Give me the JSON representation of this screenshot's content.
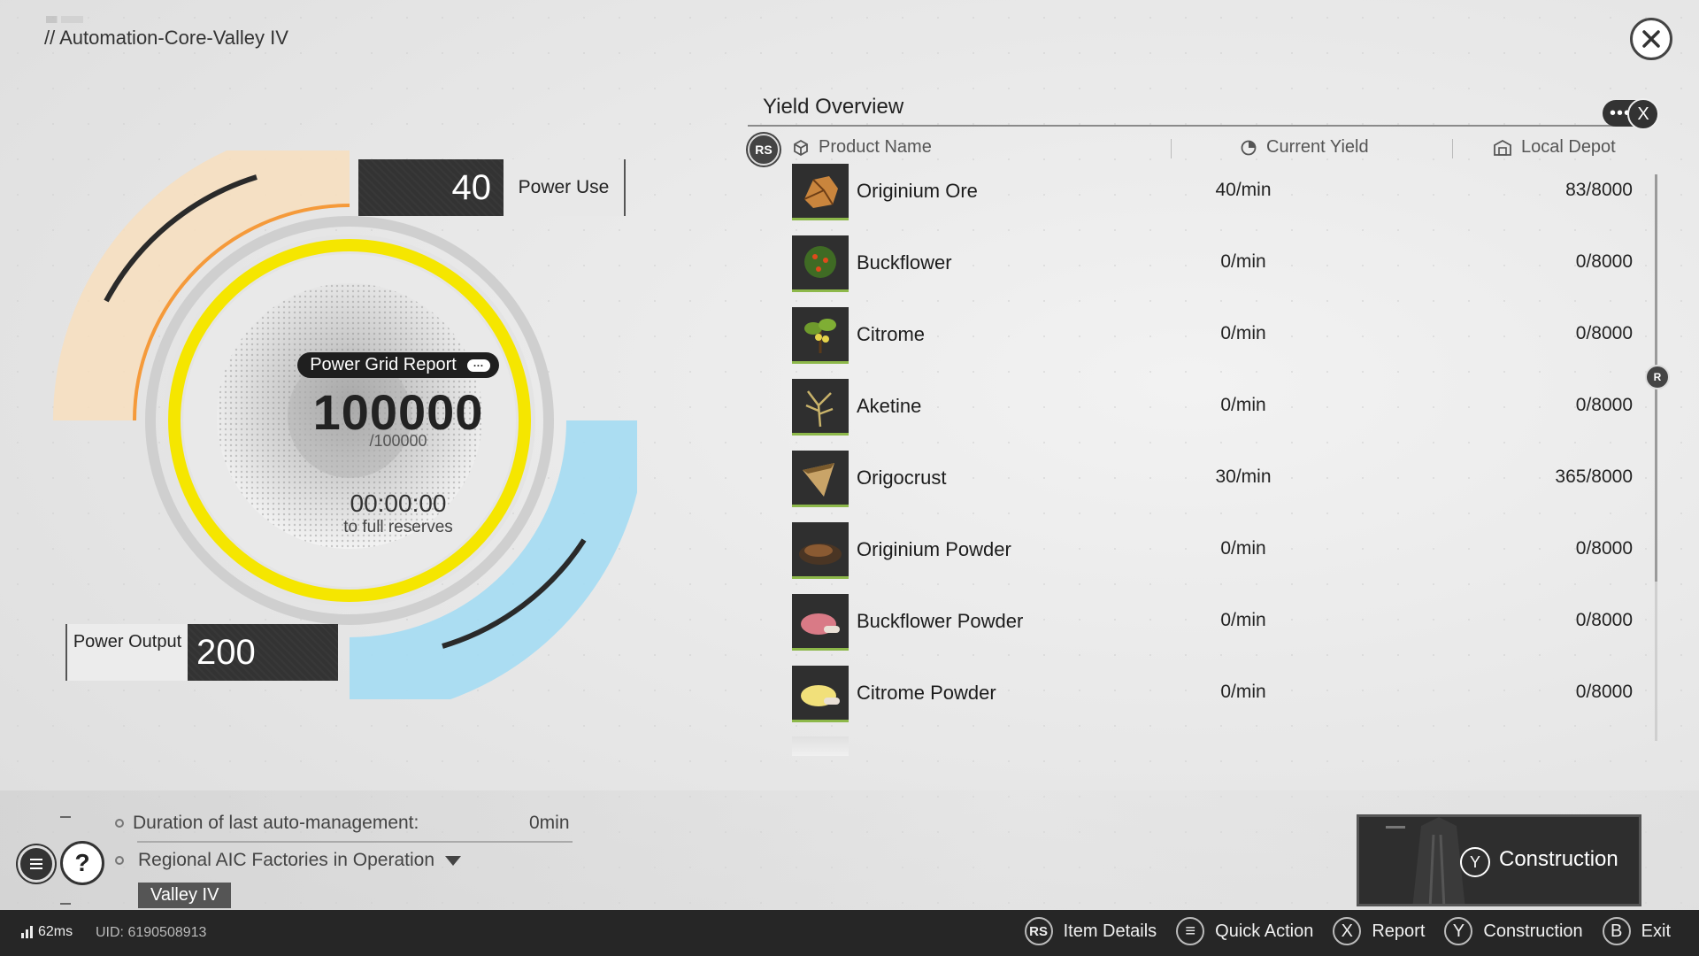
{
  "header": {
    "breadcrumb": "// Automation-Core-Valley IV"
  },
  "power": {
    "grid_report_label": "Power Grid Report",
    "current": "100000",
    "capacity": "/100000",
    "timer": "00:00:00",
    "timer_label": "to full reserves",
    "power_use_value": "40",
    "power_use_label": "Power Use",
    "power_output_value": "200",
    "power_output_label": "Power Output",
    "reserve_fill_fraction": 1.0,
    "colors": {
      "ring": "#f5e600",
      "use_arc": "#f7cf9a",
      "output_arc": "#8fd6f2"
    }
  },
  "yield": {
    "title": "Yield Overview",
    "col_product": "Product Name",
    "col_yield": "Current Yield",
    "col_depot": "Local Depot",
    "rs_badge": "RS",
    "scroll_badge": "R",
    "items": [
      {
        "name": "Originium Ore",
        "yield": "40/min",
        "depot": "83/8000",
        "icon": "originium-ore-icon"
      },
      {
        "name": "Buckflower",
        "yield": "0/min",
        "depot": "0/8000",
        "icon": "buckflower-icon"
      },
      {
        "name": "Citrome",
        "yield": "0/min",
        "depot": "0/8000",
        "icon": "citrome-icon"
      },
      {
        "name": "Aketine",
        "yield": "0/min",
        "depot": "0/8000",
        "icon": "aketine-icon"
      },
      {
        "name": "Origocrust",
        "yield": "30/min",
        "depot": "365/8000",
        "icon": "origocrust-icon"
      },
      {
        "name": "Originium Powder",
        "yield": "0/min",
        "depot": "0/8000",
        "icon": "originium-powder-icon"
      },
      {
        "name": "Buckflower Powder",
        "yield": "0/min",
        "depot": "0/8000",
        "icon": "buckflower-powder-icon"
      },
      {
        "name": "Citrome Powder",
        "yield": "0/min",
        "depot": "0/8000",
        "icon": "citrome-powder-icon"
      }
    ]
  },
  "info": {
    "auto_mgmt_label": "Duration of last auto-management:",
    "auto_mgmt_value": "0min",
    "factories_label": "Regional AIC Factories in Operation",
    "region_chip": "Valley IV"
  },
  "construction_card": {
    "button": "Y",
    "label": "Construction"
  },
  "footer": {
    "ping": "62ms",
    "uid": "UID: 6190508913",
    "hints": [
      {
        "button": "RS",
        "label": "Item Details"
      },
      {
        "button": "≡",
        "label": "Quick Action"
      },
      {
        "button": "X",
        "label": "Report"
      },
      {
        "button": "Y",
        "label": "Construction"
      },
      {
        "button": "B",
        "label": "Exit"
      }
    ]
  }
}
